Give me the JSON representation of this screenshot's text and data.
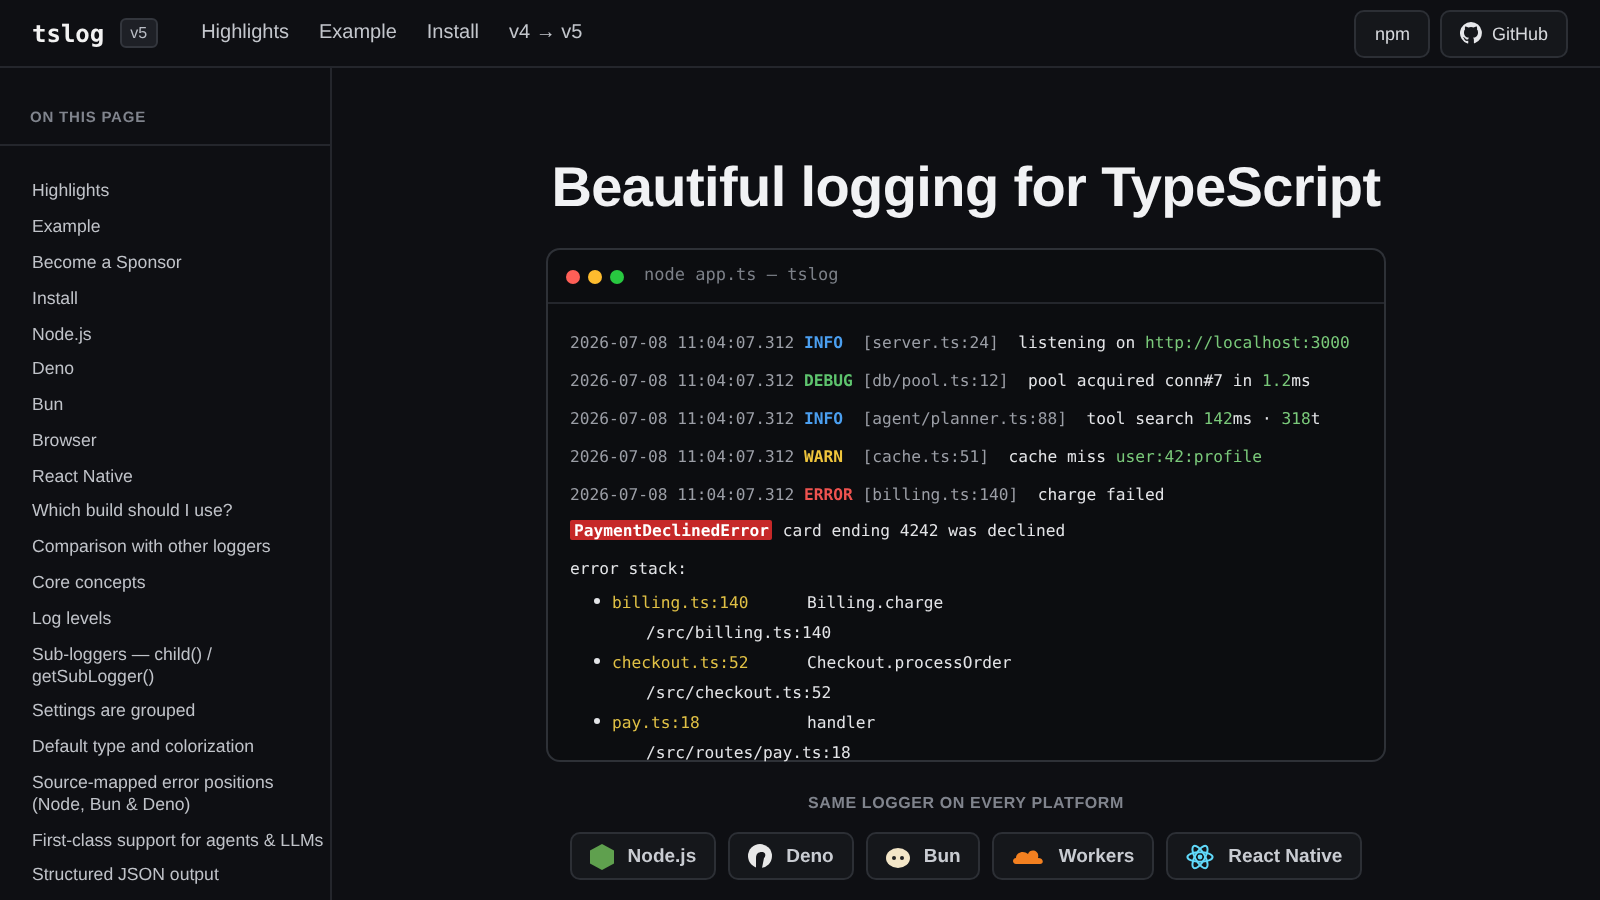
{
  "header": {
    "logo": "tslog",
    "version": "v5",
    "nav": [
      "Highlights",
      "Example",
      "Install",
      "v4 → v5"
    ],
    "buttons": [
      {
        "label": "npm",
        "kind": "plain"
      },
      {
        "label": "GitHub",
        "kind": "github"
      }
    ]
  },
  "sidebar": {
    "heading": "ON THIS PAGE",
    "items": [
      "Highlights",
      "Example",
      "Become a Sponsor",
      "Install",
      "Node.js",
      "Deno",
      "Bun",
      "Browser",
      "React Native",
      "Which build should I use?",
      "Comparison with other loggers",
      "Core concepts",
      "Log levels",
      "Sub-loggers — child() / getSubLogger()",
      "Settings are grouped",
      "Default type and colorization",
      "Source-mapped error positions (Node, Bun & Deno)",
      "First-class support for agents & LLMs",
      "Structured JSON output"
    ]
  },
  "title": "Beautiful logging for TypeScript",
  "terminal": {
    "title": "node app.ts — tslog",
    "lines": [
      {
        "segments": [
          {
            "text": "2026-07-08 11:04:07.312 ",
            "kind": "dim"
          },
          {
            "text": "INFO ",
            "kind": "info"
          },
          {
            "text": " [server.ts:24]  ",
            "kind": "dim"
          },
          {
            "text": "listening on ",
            "kind": "text"
          },
          {
            "text": "http://localhost:3000",
            "kind": "green"
          }
        ]
      },
      {
        "segments": [
          {
            "text": "2026-07-08 11:04:07.312 ",
            "kind": "dim"
          },
          {
            "text": "DEBUG",
            "kind": "debug"
          },
          {
            "text": " [db/pool.ts:12]  ",
            "kind": "dim"
          },
          {
            "text": "pool acquired conn#7 in ",
            "kind": "text"
          },
          {
            "text": "1.2",
            "kind": "green"
          },
          {
            "text": "ms",
            "kind": "text"
          }
        ]
      },
      {
        "segments": [
          {
            "text": "2026-07-08 11:04:07.312 ",
            "kind": "dim"
          },
          {
            "text": "INFO ",
            "kind": "info"
          },
          {
            "text": " [agent/planner.ts:88]  ",
            "kind": "dim"
          },
          {
            "text": "tool search ",
            "kind": "text"
          },
          {
            "text": "142",
            "kind": "green"
          },
          {
            "text": "ms · ",
            "kind": "text"
          },
          {
            "text": "318",
            "kind": "green"
          },
          {
            "text": "t",
            "kind": "text"
          }
        ]
      },
      {
        "segments": [
          {
            "text": "2026-07-08 11:04:07.312 ",
            "kind": "dim"
          },
          {
            "text": "WARN ",
            "kind": "warn"
          },
          {
            "text": " [cache.ts:51]  ",
            "kind": "dim"
          },
          {
            "text": "cache miss ",
            "kind": "text"
          },
          {
            "text": "user:42:profile",
            "kind": "green"
          }
        ]
      },
      {
        "segments": [
          {
            "text": "2026-07-08 11:04:07.312 ",
            "kind": "dim"
          },
          {
            "text": "ERROR",
            "kind": "error"
          },
          {
            "text": " [billing.ts:140]  ",
            "kind": "dim"
          },
          {
            "text": "charge failed",
            "kind": "text"
          }
        ]
      },
      {
        "segments": [
          {
            "text": "PaymentDeclinedError",
            "kind": "badge"
          },
          {
            "text": " card ending 4242 was declined",
            "kind": "text"
          }
        ]
      },
      {
        "segments": [
          {
            "text": "error stack:",
            "kind": "text"
          }
        ]
      }
    ],
    "frames": [
      {
        "file": "billing.ts:140",
        "func": "Billing.charge",
        "path": "/src/billing.ts:140"
      },
      {
        "file": "checkout.ts:52",
        "func": "Checkout.processOrder",
        "path": "/src/checkout.ts:52"
      },
      {
        "file": "pay.ts:18",
        "func": "handler",
        "path": "/src/routes/pay.ts:18"
      }
    ]
  },
  "platforms": {
    "heading": "SAME LOGGER ON EVERY PLATFORM",
    "items": [
      {
        "label": "Node.js",
        "kind": "node"
      },
      {
        "label": "Deno",
        "kind": "deno"
      },
      {
        "label": "Bun",
        "kind": "bun"
      },
      {
        "label": "Workers",
        "kind": "workers"
      },
      {
        "label": "React Native",
        "kind": "react"
      }
    ]
  }
}
